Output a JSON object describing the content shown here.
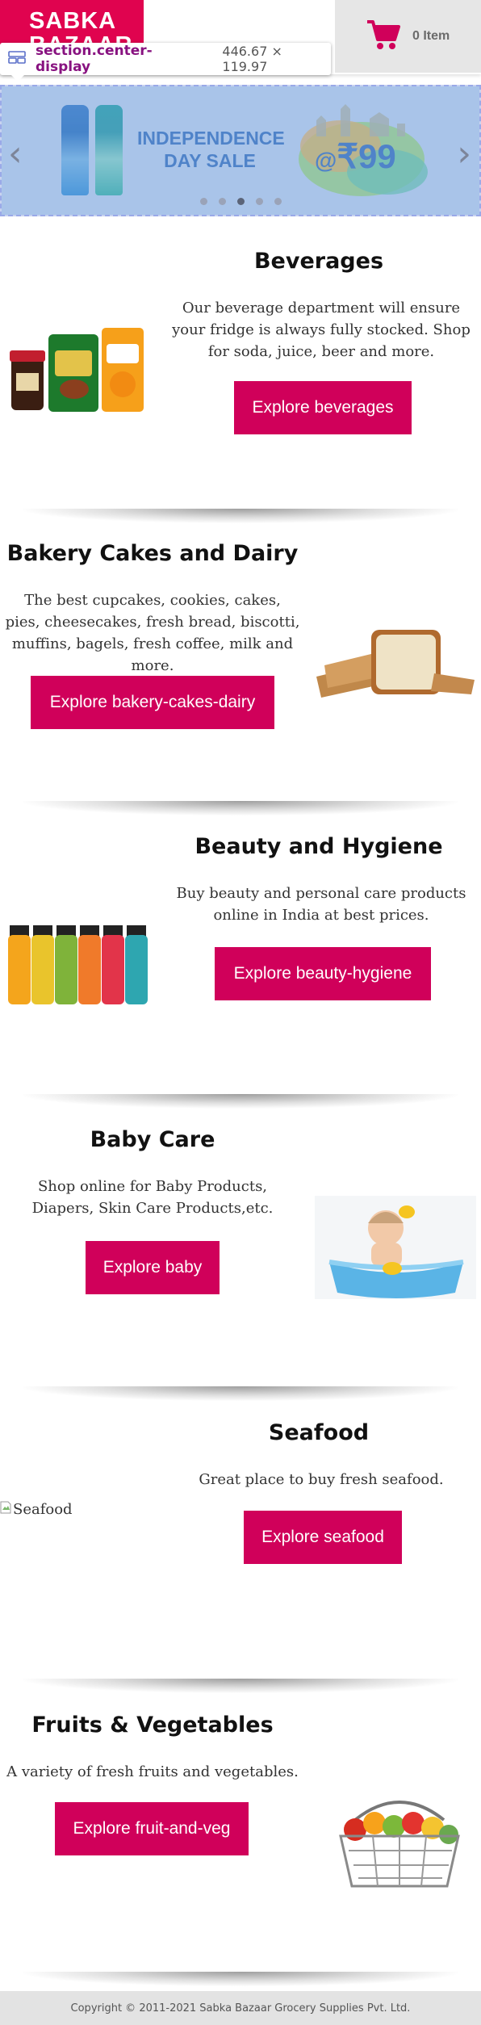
{
  "header": {
    "logo_line1": "SABKA",
    "logo_line2": "BAZAAR",
    "cart_label": "0 Item",
    "cart_icon": "shopping-cart-icon",
    "brand_color": "#e0034f"
  },
  "inspector": {
    "selector": "section.center-display",
    "dimensions": "446.67 × 119.97",
    "icon": "layout-grid-icon"
  },
  "carousel": {
    "sale_line1": "INDEPENDENCE",
    "sale_line2": "DAY SALE",
    "price_prefix": "@",
    "price_currency": "₹",
    "price_value": "99",
    "prev_icon": "chevron-left-icon",
    "next_icon": "chevron-right-icon",
    "dot_count": 5,
    "active_dot": 3
  },
  "categories": [
    {
      "title": "Beverages",
      "description": "Our beverage department will ensure your fridge is always fully stocked. Shop for soda, juice, beer and more.",
      "button": "Explore beverages"
    },
    {
      "title": "Bakery Cakes and Dairy",
      "description": "The best cupcakes, cookies, cakes, pies, cheesecakes, fresh bread, biscotti, muffins, bagels, fresh coffee, milk and more.",
      "button": "Explore bakery-cakes-dairy"
    },
    {
      "title": "Beauty and Hygiene",
      "description": "Buy beauty and personal care products online in India at best prices.",
      "button": "Explore beauty-hygiene"
    },
    {
      "title": "Baby Care",
      "description": "Shop online for Baby Products, Diapers, Skin Care Products,etc.",
      "button": "Explore baby"
    },
    {
      "title": "Seafood",
      "description": "Great place to buy fresh seafood.",
      "button": "Explore seafood",
      "image_alt": "Seafood"
    },
    {
      "title": "Fruits & Vegetables",
      "description": "A variety of fresh fruits and vegetables.",
      "button": "Explore fruit-and-veg"
    }
  ],
  "footer": {
    "copyright": "Copyright © 2011-2021 Sabka Bazaar Grocery Supplies Pvt. Ltd."
  },
  "colors": {
    "accent": "#d0005a",
    "footer_bg": "#e3e3e3",
    "cart_bg": "#e6e6e6"
  }
}
